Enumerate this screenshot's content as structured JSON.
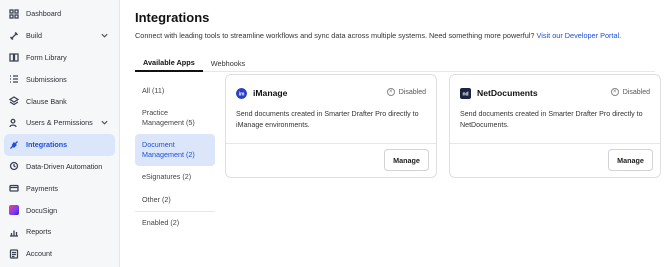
{
  "sidebar": {
    "items": [
      {
        "label": "Dashboard",
        "icon": "grid-icon"
      },
      {
        "label": "Build",
        "icon": "wrench-icon",
        "expandable": true
      },
      {
        "label": "Form Library",
        "icon": "book-icon"
      },
      {
        "label": "Submissions",
        "icon": "list-icon"
      },
      {
        "label": "Clause Bank",
        "icon": "layers-icon"
      },
      {
        "label": "Users & Permissions",
        "icon": "users-icon",
        "expandable": true
      },
      {
        "label": "Integrations",
        "icon": "plug-icon",
        "active": true
      },
      {
        "label": "Data-Driven Automation",
        "icon": "flow-icon"
      },
      {
        "label": "Payments",
        "icon": "card-icon"
      },
      {
        "label": "DocuSign",
        "icon": "docusign-logo"
      },
      {
        "label": "Reports",
        "icon": "chart-icon"
      },
      {
        "label": "Account",
        "icon": "account-icon"
      }
    ]
  },
  "header": {
    "title": "Integrations",
    "subtitle": "Connect with leading tools to streamline workflows and sync data across multiple systems. Need something more powerful?",
    "link": "Visit our Developer Portal."
  },
  "tabs": [
    {
      "label": "Available Apps",
      "active": true
    },
    {
      "label": "Webhooks",
      "active": false
    }
  ],
  "filters": [
    {
      "label": "All (11)"
    },
    {
      "label": "Practice Management (5)"
    },
    {
      "label": "Document Management (2)",
      "active": true
    },
    {
      "label": "eSignatures (2)"
    },
    {
      "label": "Other (2)"
    },
    {
      "label": "Enabled (2)"
    }
  ],
  "cards": [
    {
      "name": "iManage",
      "status": "Disabled",
      "description": "Send documents created in Smarter Drafter Pro directly to iManage environments.",
      "button": "Manage",
      "logo": "imanage-logo",
      "color": "#2a3ec9"
    },
    {
      "name": "NetDocuments",
      "status": "Disabled",
      "description": "Send documents created in Smarter Drafter Pro directly to NetDocuments.",
      "button": "Manage",
      "logo": "netdocuments-logo",
      "color": "#1b2440"
    }
  ],
  "colors": {
    "accent": "#1d4fd7",
    "active_bg": "#dce6fb"
  }
}
